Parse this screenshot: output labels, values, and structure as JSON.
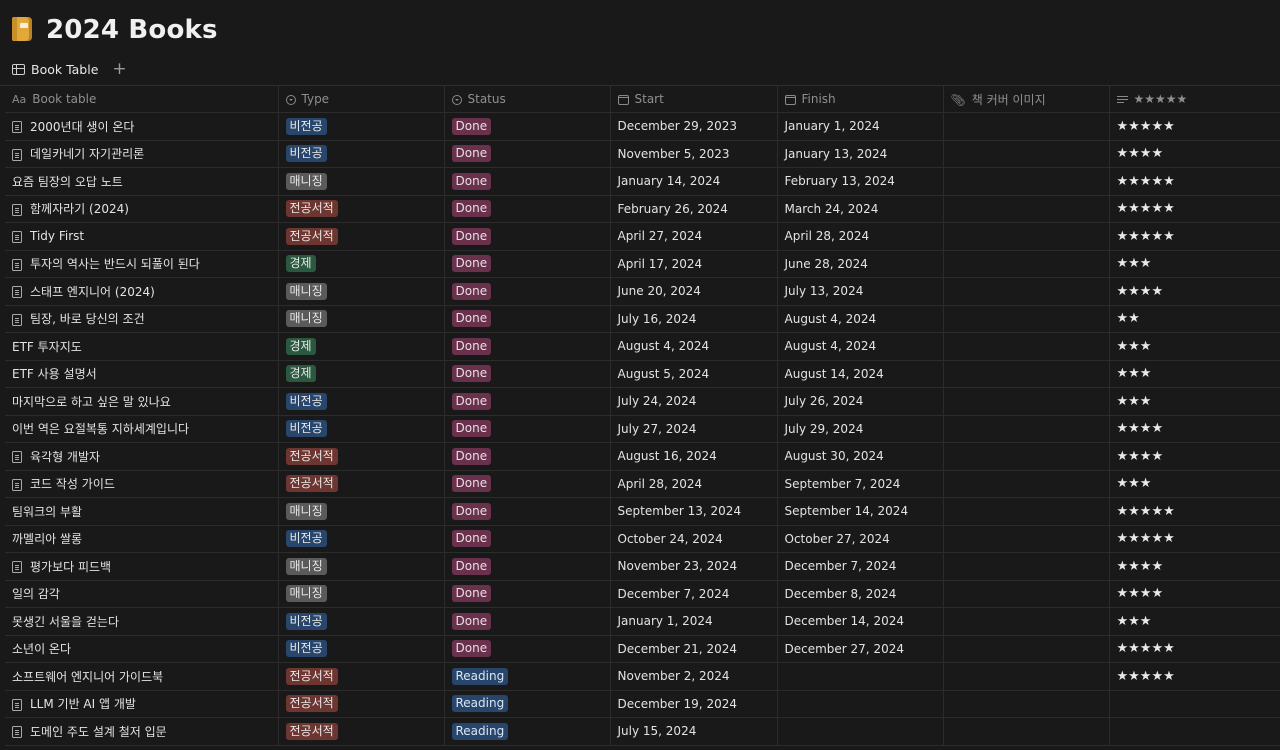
{
  "page": {
    "title": "2024 Books",
    "emoji_icon": "book-emoji-icon"
  },
  "tabs": {
    "active_label": "Book Table",
    "add_symbol": "+"
  },
  "columns": [
    {
      "label": "Book table",
      "icon": "Aa"
    },
    {
      "label": "Type",
      "icon": "select-icon"
    },
    {
      "label": "Status",
      "icon": "status-icon"
    },
    {
      "label": "Start",
      "icon": "calendar-icon"
    },
    {
      "label": "Finish",
      "icon": "calendar-icon"
    },
    {
      "label": "책 커버 이미지",
      "icon": "paperclip-icon"
    },
    {
      "label": "★★★★★",
      "icon": "text-lines-icon"
    }
  ],
  "tag_colors": {
    "비전공": "#28456c",
    "매니징": "#5a5a5a",
    "전공서적": "#6e3630",
    "경제": "#2b593f",
    "Done": "#69314c",
    "Reading": "#28456c"
  },
  "rows": [
    {
      "title": "2000년대 생이 온다",
      "doc": true,
      "type": "비전공",
      "status": "Done",
      "start": "December 29, 2023",
      "finish": "January 1, 2024",
      "rating": "★★★★★"
    },
    {
      "title": "데일카네기 자기관리론",
      "doc": true,
      "type": "비전공",
      "status": "Done",
      "start": "November 5, 2023",
      "finish": "January 13, 2024",
      "rating": "★★★★"
    },
    {
      "title": "요즘 팀장의 오답 노트",
      "doc": false,
      "type": "매니징",
      "status": "Done",
      "start": "January 14, 2024",
      "finish": "February 13, 2024",
      "rating": "★★★★★"
    },
    {
      "title": "함께자라기 (2024)",
      "doc": true,
      "type": "전공서적",
      "status": "Done",
      "start": "February 26, 2024",
      "finish": "March 24, 2024",
      "rating": "★★★★★"
    },
    {
      "title": "Tidy First",
      "doc": true,
      "type": "전공서적",
      "status": "Done",
      "start": "April 27, 2024",
      "finish": "April 28, 2024",
      "rating": "★★★★★"
    },
    {
      "title": "투자의 역사는 반드시 되풀이 된다",
      "doc": true,
      "type": "경제",
      "status": "Done",
      "start": "April 17, 2024",
      "finish": "June 28, 2024",
      "rating": "★★★"
    },
    {
      "title": "스태프 엔지니어 (2024)",
      "doc": true,
      "type": "매니징",
      "status": "Done",
      "start": "June 20, 2024",
      "finish": "July 13, 2024",
      "rating": "★★★★"
    },
    {
      "title": "팀장, 바로 당신의 조건",
      "doc": true,
      "type": "매니징",
      "status": "Done",
      "start": "July 16, 2024",
      "finish": "August 4, 2024",
      "rating": "★★"
    },
    {
      "title": "ETF 투자지도",
      "doc": false,
      "type": "경제",
      "status": "Done",
      "start": "August 4, 2024",
      "finish": "August 4, 2024",
      "rating": "★★★"
    },
    {
      "title": "ETF 사용 설명서",
      "doc": false,
      "type": "경제",
      "status": "Done",
      "start": "August 5, 2024",
      "finish": "August 14, 2024",
      "rating": "★★★"
    },
    {
      "title": "마지막으로 하고 싶은 말 있나요",
      "doc": false,
      "type": "비전공",
      "status": "Done",
      "start": "July 24, 2024",
      "finish": "July 26, 2024",
      "rating": "★★★"
    },
    {
      "title": "이번 역은 요절복통 지하세계입니다",
      "doc": false,
      "type": "비전공",
      "status": "Done",
      "start": "July 27, 2024",
      "finish": "July 29, 2024",
      "rating": "★★★★"
    },
    {
      "title": "육각형 개발자",
      "doc": true,
      "type": "전공서적",
      "status": "Done",
      "start": "August 16, 2024",
      "finish": "August 30, 2024",
      "rating": "★★★★"
    },
    {
      "title": "코드 작성 가이드",
      "doc": true,
      "type": "전공서적",
      "status": "Done",
      "start": "April 28, 2024",
      "finish": "September 7, 2024",
      "rating": "★★★"
    },
    {
      "title": "팀워크의 부활",
      "doc": false,
      "type": "매니징",
      "status": "Done",
      "start": "September 13, 2024",
      "finish": "September 14, 2024",
      "rating": "★★★★★"
    },
    {
      "title": "까멜리아 쌀롱",
      "doc": false,
      "type": "비전공",
      "status": "Done",
      "start": "October 24, 2024",
      "finish": "October 27, 2024",
      "rating": "★★★★★"
    },
    {
      "title": "평가보다 피드백",
      "doc": true,
      "type": "매니징",
      "status": "Done",
      "start": "November 23, 2024",
      "finish": "December 7, 2024",
      "rating": "★★★★"
    },
    {
      "title": "일의 감각",
      "doc": false,
      "type": "매니징",
      "status": "Done",
      "start": "December 7, 2024",
      "finish": "December 8, 2024",
      "rating": "★★★★"
    },
    {
      "title": "못생긴 서울을 걷는다",
      "doc": false,
      "type": "비전공",
      "status": "Done",
      "start": "January 1, 2024",
      "finish": "December 14, 2024",
      "rating": "★★★"
    },
    {
      "title": "소년이 온다",
      "doc": false,
      "type": "비전공",
      "status": "Done",
      "start": "December 21, 2024",
      "finish": "December 27, 2024",
      "rating": "★★★★★"
    },
    {
      "title": "소프트웨어 엔지니어 가이드북",
      "doc": false,
      "type": "전공서적",
      "status": "Reading",
      "start": "November 2, 2024",
      "finish": "",
      "rating": "★★★★★"
    },
    {
      "title": "LLM 기반 AI 앱 개발",
      "doc": true,
      "type": "전공서적",
      "status": "Reading",
      "start": "December 19, 2024",
      "finish": "",
      "rating": ""
    },
    {
      "title": "도메인 주도 설계 철저 입문",
      "doc": true,
      "type": "전공서적",
      "status": "Reading",
      "start": "July 15, 2024",
      "finish": "",
      "rating": ""
    }
  ]
}
